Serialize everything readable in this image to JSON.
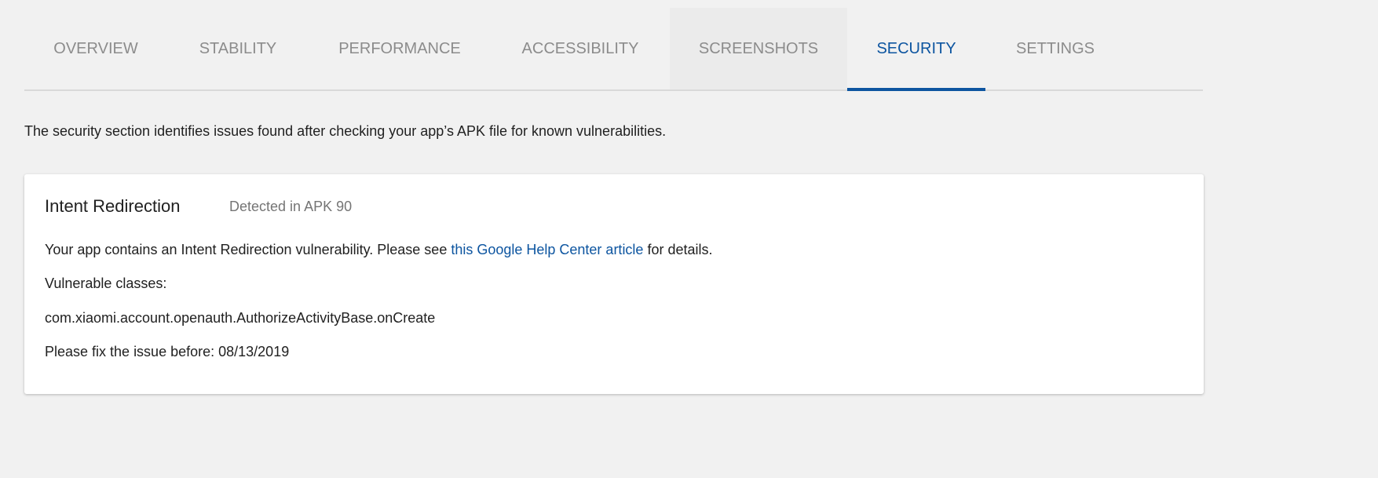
{
  "tabs": [
    {
      "label": "OVERVIEW"
    },
    {
      "label": "STABILITY"
    },
    {
      "label": "PERFORMANCE"
    },
    {
      "label": "ACCESSIBILITY"
    },
    {
      "label": "SCREENSHOTS"
    },
    {
      "label": "SECURITY"
    },
    {
      "label": "SETTINGS"
    }
  ],
  "active_tab": "SECURITY",
  "intro": "The security section identifies issues found after checking your app’s APK file for known vulnerabilities.",
  "issue": {
    "title": "Intent Redirection",
    "detected": "Detected in APK 90",
    "desc_before": "Your app contains an Intent Redirection vulnerability. Please see ",
    "desc_link": "this Google Help Center article",
    "desc_after": " for details.",
    "classes_label": "Vulnerable classes:",
    "class_name": "com.xiaomi.account.openauth.AuthorizeActivityBase.onCreate",
    "deadline": "Please fix the issue before: 08/13/2019"
  },
  "colors": {
    "accent": "#0d55a0",
    "background": "#f1f1f1"
  }
}
